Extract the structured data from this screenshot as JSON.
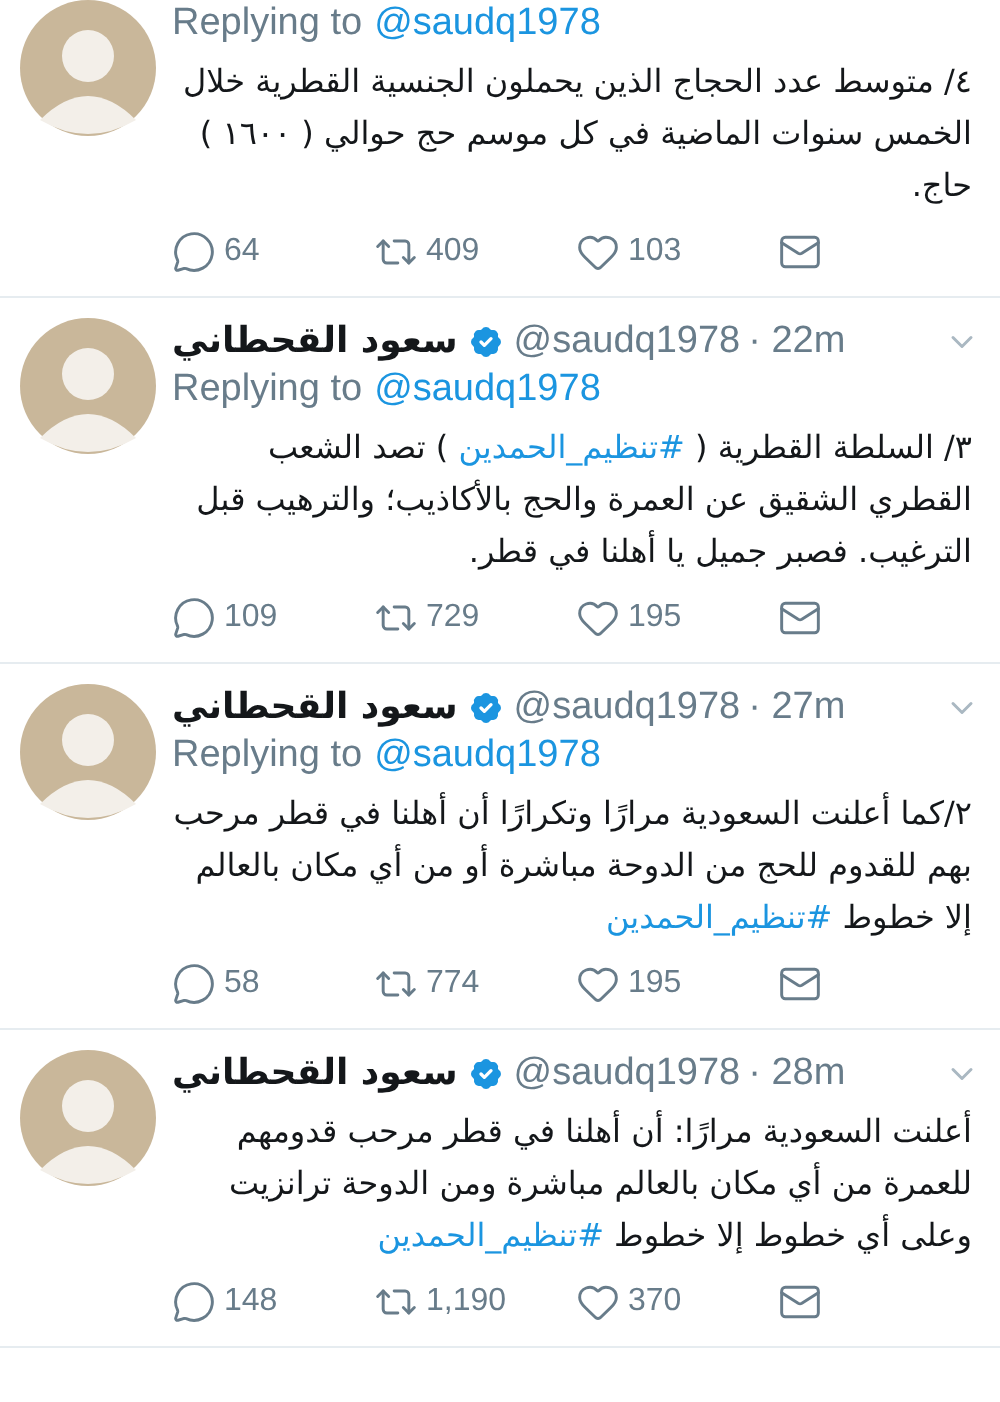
{
  "tweets": [
    {
      "replying_label": "Replying to",
      "replying_to": "@saudq1978",
      "body": [
        {
          "kind": "plain",
          "text": "٤/ متوسط عدد الحجاج الذين يحملون الجنسية القطرية خلال الخمس سنوات الماضية في كل موسم حج  حوالي ( ١٦٠٠ ) حاج."
        }
      ],
      "replies": "64",
      "retweets": "409",
      "likes": "103"
    },
    {
      "name": "سعود القحطاني",
      "verified": true,
      "handle": "@saudq1978",
      "time": "· 22m",
      "replying_label": "Replying to",
      "replying_to": "@saudq1978",
      "body": [
        {
          "kind": "plain",
          "text": "٣/ السلطة القطرية ( "
        },
        {
          "kind": "hashtag",
          "text": "#تنظيم_الحمدين"
        },
        {
          "kind": "plain",
          "text": " ) تصد الشعب القطري الشقيق عن العمرة والحج بالأكاذيب؛ والترهيب قبل الترغيب. فصبر جميل يا أهلنا في قطر."
        }
      ],
      "replies": "109",
      "retweets": "729",
      "likes": "195"
    },
    {
      "name": "سعود القحطاني",
      "verified": true,
      "handle": "@saudq1978",
      "time": "· 27m",
      "replying_label": "Replying to",
      "replying_to": "@saudq1978",
      "body": [
        {
          "kind": "plain",
          "text": "٢/كما أعلنت السعودية مرارًا وتكرارًا أن أهلنا في قطر مرحب بهم للقدوم للحج من الدوحة مباشرة أو من أي مكان بالعالم إلا خطوط "
        },
        {
          "kind": "hashtag",
          "text": "#تنظيم_الحمدين"
        }
      ],
      "replies": "58",
      "retweets": "774",
      "likes": "195"
    },
    {
      "name": "سعود القحطاني",
      "verified": true,
      "handle": "@saudq1978",
      "time": "· 28m",
      "body": [
        {
          "kind": "plain",
          "text": "أعلنت السعودية مرارًا: أن أهلنا في قطر مرحب قدومهم للعمرة من أي مكان بالعالم مباشرة ومن الدوحة ترانزيت وعلى أي خطوط إلا خطوط "
        },
        {
          "kind": "hashtag",
          "text": "#تنظيم_الحمدين"
        }
      ],
      "replies": "148",
      "retweets": "1,190",
      "likes": "370"
    }
  ]
}
